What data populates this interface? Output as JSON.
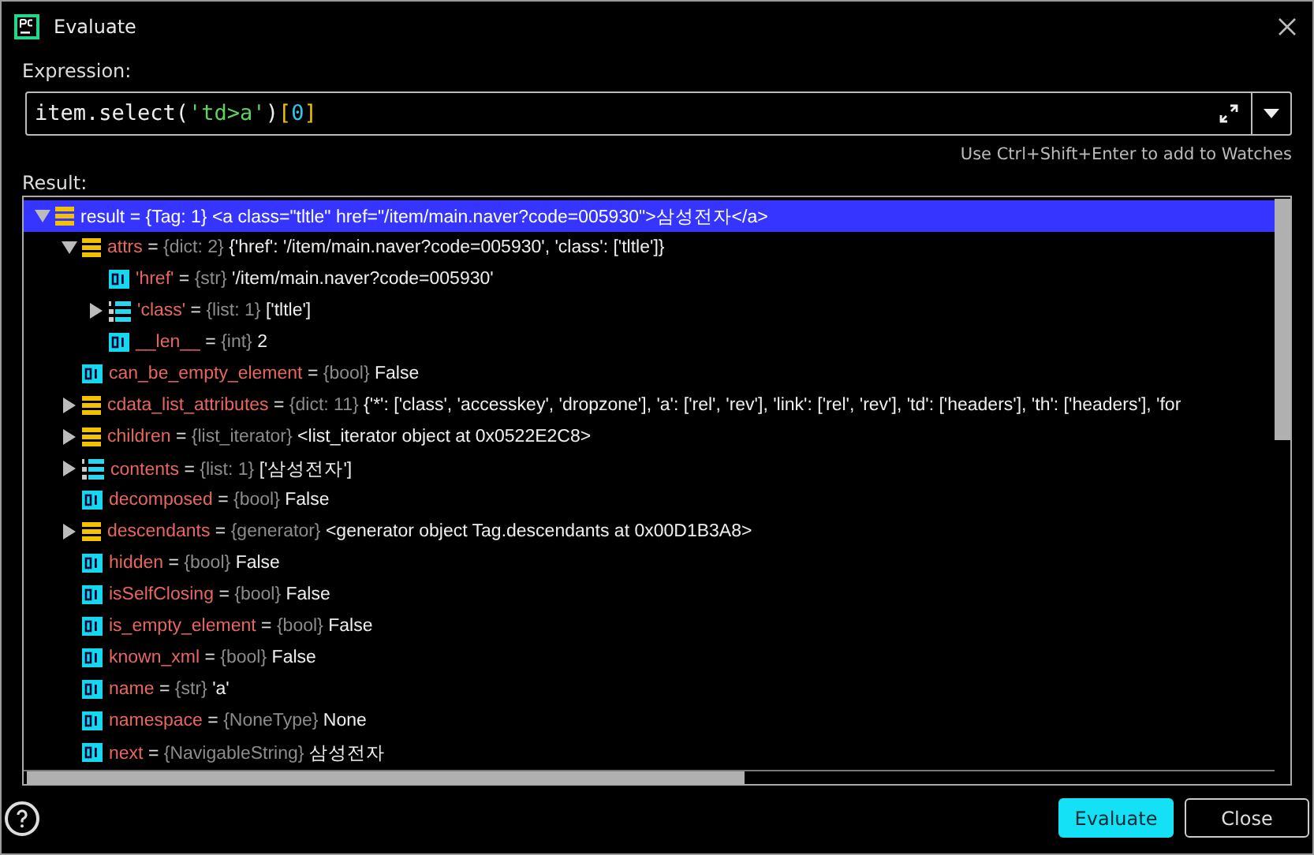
{
  "window": {
    "title": "Evaluate"
  },
  "expression": {
    "label": "Expression:",
    "tokens": [
      {
        "kind": "plain",
        "text": "item.select("
      },
      {
        "kind": "string",
        "text": "'td>a'"
      },
      {
        "kind": "plain",
        "text": ")"
      },
      {
        "kind": "bracket",
        "text": "["
      },
      {
        "kind": "number",
        "text": "0"
      },
      {
        "kind": "bracket",
        "text": "]"
      }
    ],
    "hint": "Use Ctrl+Shift+Enter to add to Watches"
  },
  "result": {
    "label": "Result:",
    "tree": [
      {
        "kind": "dict",
        "name": "result",
        "separator": "=",
        "type": "{Tag: 1}",
        "value": "<a class=\"tltle\" href=\"/item/main.naver?code=005930\">삼성전자</a>",
        "expanded": true,
        "selected": true,
        "children": [
          {
            "kind": "dict",
            "name": "attrs",
            "separator": "=",
            "type": "{dict: 2}",
            "value": "{'href': '/item/main.naver?code=005930', 'class': ['tltle']}",
            "expanded": true,
            "selected": false,
            "children": [
              {
                "kind": "primitive",
                "name": "'href'",
                "separator": "=",
                "type": "{str}",
                "value": "'/item/main.naver?code=005930'",
                "selected": false
              },
              {
                "kind": "list",
                "name": "'class'",
                "separator": "=",
                "type": "{list: 1}",
                "value": "['tltle']",
                "expanded": false,
                "selected": false
              },
              {
                "kind": "primitive",
                "name": "__len__",
                "separator": "=",
                "type": "{int}",
                "value": "2",
                "selected": false
              }
            ]
          },
          {
            "kind": "primitive",
            "name": "can_be_empty_element",
            "separator": "=",
            "type": "{bool}",
            "value": "False",
            "selected": false
          },
          {
            "kind": "dict",
            "name": "cdata_list_attributes",
            "separator": "=",
            "type": "{dict: 11}",
            "value": "{'*': ['class', 'accesskey', 'dropzone'], 'a': ['rel', 'rev'], 'link': ['rel', 'rev'], 'td': ['headers'], 'th': ['headers'], 'for",
            "expanded": false,
            "selected": false
          },
          {
            "kind": "dict",
            "name": "children",
            "separator": "=",
            "type": "{list_iterator}",
            "value": "<list_iterator object at 0x0522E2C8>",
            "expanded": false,
            "selected": false
          },
          {
            "kind": "list",
            "name": "contents",
            "separator": "=",
            "type": "{list: 1}",
            "value": "['삼성전자']",
            "expanded": false,
            "selected": false
          },
          {
            "kind": "primitive",
            "name": "decomposed",
            "separator": "=",
            "type": "{bool}",
            "value": "False",
            "selected": false
          },
          {
            "kind": "dict",
            "name": "descendants",
            "separator": "=",
            "type": "{generator}",
            "value": "<generator object Tag.descendants at 0x00D1B3A8>",
            "expanded": false,
            "selected": false
          },
          {
            "kind": "primitive",
            "name": "hidden",
            "separator": "=",
            "type": "{bool}",
            "value": "False",
            "selected": false
          },
          {
            "kind": "primitive",
            "name": "isSelfClosing",
            "separator": "=",
            "type": "{bool}",
            "value": "False",
            "selected": false
          },
          {
            "kind": "primitive",
            "name": "is_empty_element",
            "separator": "=",
            "type": "{bool}",
            "value": "False",
            "selected": false
          },
          {
            "kind": "primitive",
            "name": "known_xml",
            "separator": "=",
            "type": "{bool}",
            "value": "False",
            "selected": false
          },
          {
            "kind": "primitive",
            "name": "name",
            "separator": "=",
            "type": "{str}",
            "value": "'a'",
            "selected": false
          },
          {
            "kind": "primitive",
            "name": "namespace",
            "separator": "=",
            "type": "{NoneType}",
            "value": "None",
            "selected": false
          },
          {
            "kind": "primitive",
            "name": "next",
            "separator": "=",
            "type": "{NavigableString}",
            "value": "삼성전자",
            "selected": false
          }
        ]
      }
    ]
  },
  "buttons": [
    {
      "kind": "primary",
      "label": "Evaluate"
    },
    {
      "kind": "secondary",
      "label": "Close"
    }
  ]
}
